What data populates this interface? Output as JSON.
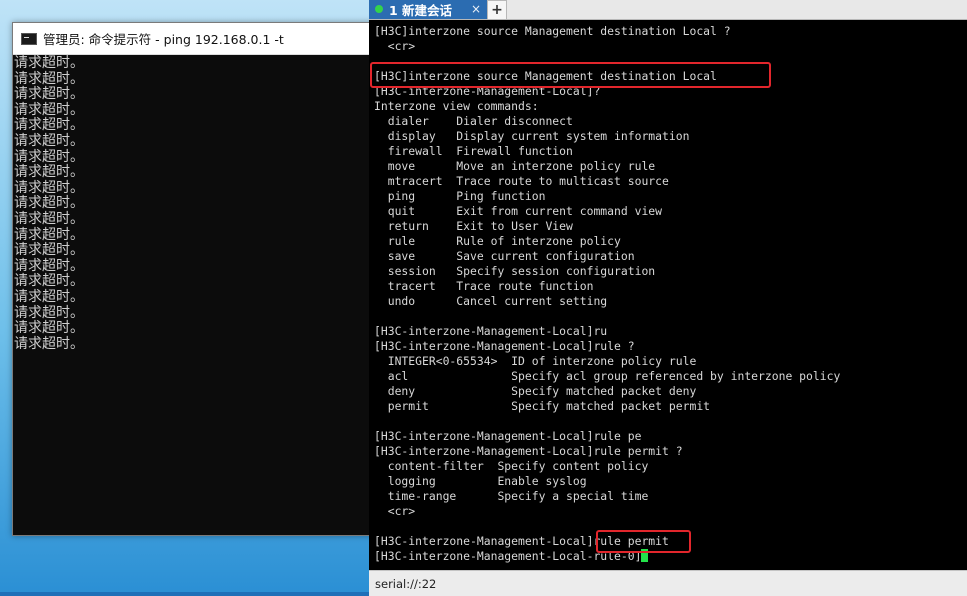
{
  "cmd_window": {
    "title": "管理员: 命令提示符 - ping  192.168.0.1 -t",
    "lines": [
      "请求超时。",
      "请求超时。",
      "请求超时。",
      "请求超时。",
      "请求超时。",
      "请求超时。",
      "请求超时。",
      "请求超时。",
      "请求超时。",
      "请求超时。",
      "请求超时。",
      "请求超时。",
      "请求超时。",
      "请求超时。",
      "请求超时。",
      "请求超时。",
      "请求超时。",
      "请求超时。",
      "请求超时。"
    ]
  },
  "terminal": {
    "tab": {
      "label": "1 新建会话",
      "close": "×",
      "add": "+"
    },
    "lines": [
      "[H3C]interzone source Management destination Local ?",
      "  <cr>",
      "",
      "[H3C]interzone source Management destination Local",
      "[H3C-interzone-Management-Local]?",
      "Interzone view commands:",
      "  dialer    Dialer disconnect",
      "  display   Display current system information",
      "  firewall  Firewall function",
      "  move      Move an interzone policy rule",
      "  mtracert  Trace route to multicast source",
      "  ping      Ping function",
      "  quit      Exit from current command view",
      "  return    Exit to User View",
      "  rule      Rule of interzone policy",
      "  save      Save current configuration",
      "  session   Specify session configuration",
      "  tracert   Trace route function",
      "  undo      Cancel current setting",
      "",
      "[H3C-interzone-Management-Local]ru",
      "[H3C-interzone-Management-Local]rule ?",
      "  INTEGER<0-65534>  ID of interzone policy rule",
      "  acl               Specify acl group referenced by interzone policy",
      "  deny              Specify matched packet deny",
      "  permit            Specify matched packet permit",
      "",
      "[H3C-interzone-Management-Local]rule pe",
      "[H3C-interzone-Management-Local]rule permit ?",
      "  content-filter  Specify content policy",
      "  logging         Enable syslog",
      "  time-range      Specify a special time",
      "  <cr>",
      "",
      "[H3C-interzone-Management-Local]rule permit"
    ],
    "prompt_line": "[H3C-interzone-Management-Local-rule-0]",
    "status": "serial://:22"
  },
  "colors": {
    "highlight": "#e2262c",
    "cursor": "#23e34a",
    "tab_active": "#2b6cb1"
  }
}
